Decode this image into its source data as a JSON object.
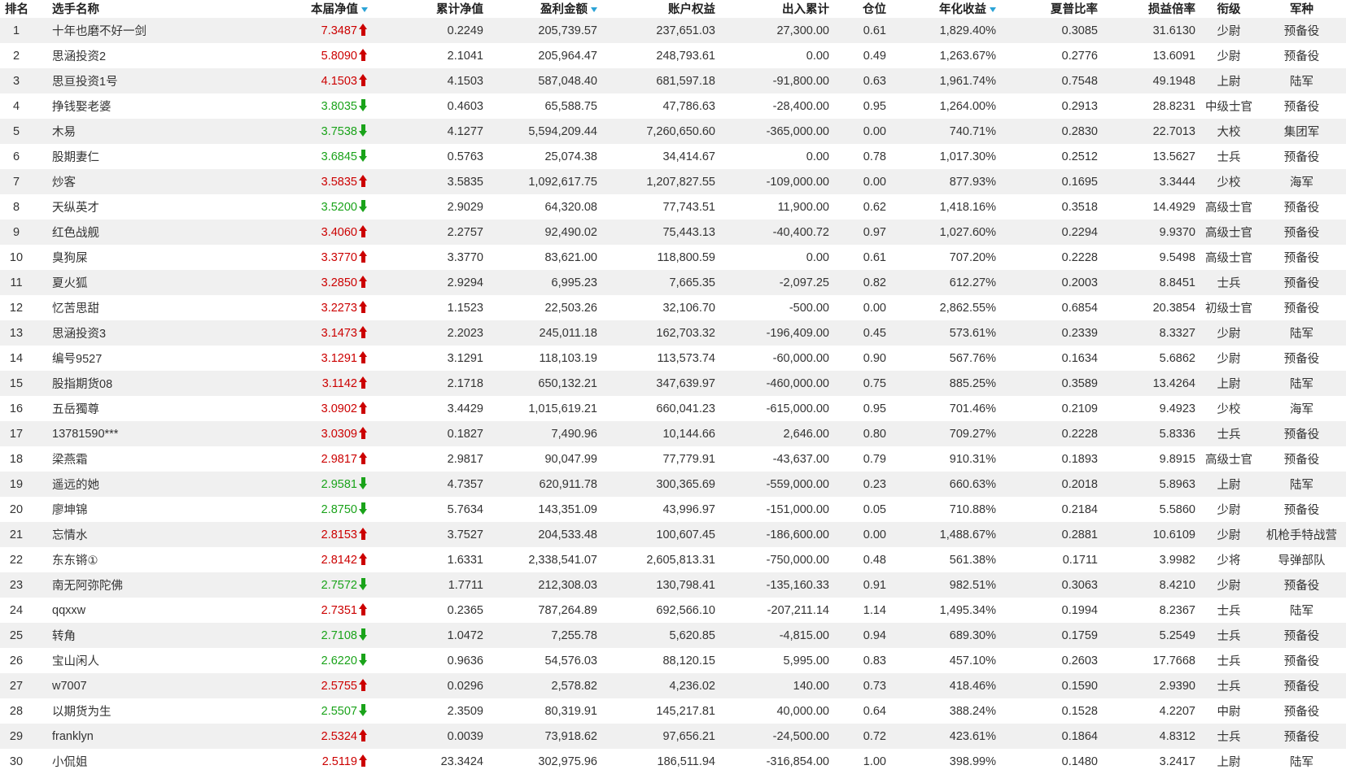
{
  "headers": {
    "rank": "排名",
    "name": "选手名称",
    "nav": "本届净值",
    "cum_nav": "累计净值",
    "profit": "盈利金额",
    "equity": "账户权益",
    "flow": "出入累计",
    "position": "仓位",
    "annual": "年化收益",
    "sharpe": "夏普比率",
    "pl_ratio": "损益倍率",
    "rank_title": "衔级",
    "army": "军种"
  },
  "rows": [
    {
      "rank": "1",
      "name": "十年也磨不好一剑",
      "nav": "7.3487",
      "dir": "up",
      "cum_nav": "0.2249",
      "profit": "205,739.57",
      "equity": "237,651.03",
      "flow": "27,300.00",
      "position": "0.61",
      "annual": "1,829.40%",
      "sharpe": "0.3085",
      "pl_ratio": "31.6130",
      "title": "少尉",
      "army": "预备役"
    },
    {
      "rank": "2",
      "name": "思涵投资2",
      "nav": "5.8090",
      "dir": "up",
      "cum_nav": "2.1041",
      "profit": "205,964.47",
      "equity": "248,793.61",
      "flow": "0.00",
      "position": "0.49",
      "annual": "1,263.67%",
      "sharpe": "0.2776",
      "pl_ratio": "13.6091",
      "title": "少尉",
      "army": "预备役"
    },
    {
      "rank": "3",
      "name": "思亘投资1号",
      "nav": "4.1503",
      "dir": "up",
      "cum_nav": "4.1503",
      "profit": "587,048.40",
      "equity": "681,597.18",
      "flow": "-91,800.00",
      "position": "0.63",
      "annual": "1,961.74%",
      "sharpe": "0.7548",
      "pl_ratio": "49.1948",
      "title": "上尉",
      "army": "陆军"
    },
    {
      "rank": "4",
      "name": "挣钱娶老婆",
      "nav": "3.8035",
      "dir": "down",
      "cum_nav": "0.4603",
      "profit": "65,588.75",
      "equity": "47,786.63",
      "flow": "-28,400.00",
      "position": "0.95",
      "annual": "1,264.00%",
      "sharpe": "0.2913",
      "pl_ratio": "28.8231",
      "title": "中级士官",
      "army": "预备役"
    },
    {
      "rank": "5",
      "name": "木易",
      "nav": "3.7538",
      "dir": "down",
      "cum_nav": "4.1277",
      "profit": "5,594,209.44",
      "equity": "7,260,650.60",
      "flow": "-365,000.00",
      "position": "0.00",
      "annual": "740.71%",
      "sharpe": "0.2830",
      "pl_ratio": "22.7013",
      "title": "大校",
      "army": "集团军"
    },
    {
      "rank": "6",
      "name": "股期妻仁",
      "nav": "3.6845",
      "dir": "down",
      "cum_nav": "0.5763",
      "profit": "25,074.38",
      "equity": "34,414.67",
      "flow": "0.00",
      "position": "0.78",
      "annual": "1,017.30%",
      "sharpe": "0.2512",
      "pl_ratio": "13.5627",
      "title": "士兵",
      "army": "预备役"
    },
    {
      "rank": "7",
      "name": "炒客",
      "nav": "3.5835",
      "dir": "up",
      "cum_nav": "3.5835",
      "profit": "1,092,617.75",
      "equity": "1,207,827.55",
      "flow": "-109,000.00",
      "position": "0.00",
      "annual": "877.93%",
      "sharpe": "0.1695",
      "pl_ratio": "3.3444",
      "title": "少校",
      "army": "海军"
    },
    {
      "rank": "8",
      "name": "天纵英才",
      "nav": "3.5200",
      "dir": "down",
      "cum_nav": "2.9029",
      "profit": "64,320.08",
      "equity": "77,743.51",
      "flow": "11,900.00",
      "position": "0.62",
      "annual": "1,418.16%",
      "sharpe": "0.3518",
      "pl_ratio": "14.4929",
      "title": "高级士官",
      "army": "预备役"
    },
    {
      "rank": "9",
      "name": "红色战舰",
      "nav": "3.4060",
      "dir": "up",
      "cum_nav": "2.2757",
      "profit": "92,490.02",
      "equity": "75,443.13",
      "flow": "-40,400.72",
      "position": "0.97",
      "annual": "1,027.60%",
      "sharpe": "0.2294",
      "pl_ratio": "9.9370",
      "title": "高级士官",
      "army": "预备役"
    },
    {
      "rank": "10",
      "name": "臭狗屎",
      "nav": "3.3770",
      "dir": "up",
      "cum_nav": "3.3770",
      "profit": "83,621.00",
      "equity": "118,800.59",
      "flow": "0.00",
      "position": "0.61",
      "annual": "707.20%",
      "sharpe": "0.2228",
      "pl_ratio": "9.5498",
      "title": "高级士官",
      "army": "预备役"
    },
    {
      "rank": "11",
      "name": "夏火狐",
      "nav": "3.2850",
      "dir": "up",
      "cum_nav": "2.9294",
      "profit": "6,995.23",
      "equity": "7,665.35",
      "flow": "-2,097.25",
      "position": "0.82",
      "annual": "612.27%",
      "sharpe": "0.2003",
      "pl_ratio": "8.8451",
      "title": "士兵",
      "army": "预备役"
    },
    {
      "rank": "12",
      "name": "忆苦思甜",
      "nav": "3.2273",
      "dir": "up",
      "cum_nav": "1.1523",
      "profit": "22,503.26",
      "equity": "32,106.70",
      "flow": "-500.00",
      "position": "0.00",
      "annual": "2,862.55%",
      "sharpe": "0.6854",
      "pl_ratio": "20.3854",
      "title": "初级士官",
      "army": "预备役"
    },
    {
      "rank": "13",
      "name": "思涵投资3",
      "nav": "3.1473",
      "dir": "up",
      "cum_nav": "2.2023",
      "profit": "245,011.18",
      "equity": "162,703.32",
      "flow": "-196,409.00",
      "position": "0.45",
      "annual": "573.61%",
      "sharpe": "0.2339",
      "pl_ratio": "8.3327",
      "title": "少尉",
      "army": "陆军"
    },
    {
      "rank": "14",
      "name": "编号9527",
      "nav": "3.1291",
      "dir": "up",
      "cum_nav": "3.1291",
      "profit": "118,103.19",
      "equity": "113,573.74",
      "flow": "-60,000.00",
      "position": "0.90",
      "annual": "567.76%",
      "sharpe": "0.1634",
      "pl_ratio": "5.6862",
      "title": "少尉",
      "army": "预备役"
    },
    {
      "rank": "15",
      "name": "股指期货08",
      "nav": "3.1142",
      "dir": "up",
      "cum_nav": "2.1718",
      "profit": "650,132.21",
      "equity": "347,639.97",
      "flow": "-460,000.00",
      "position": "0.75",
      "annual": "885.25%",
      "sharpe": "0.3589",
      "pl_ratio": "13.4264",
      "title": "上尉",
      "army": "陆军"
    },
    {
      "rank": "16",
      "name": "五岳獨尊",
      "nav": "3.0902",
      "dir": "up",
      "cum_nav": "3.4429",
      "profit": "1,015,619.21",
      "equity": "660,041.23",
      "flow": "-615,000.00",
      "position": "0.95",
      "annual": "701.46%",
      "sharpe": "0.2109",
      "pl_ratio": "9.4923",
      "title": "少校",
      "army": "海军"
    },
    {
      "rank": "17",
      "name": "13781590***",
      "nav": "3.0309",
      "dir": "up",
      "cum_nav": "0.1827",
      "profit": "7,490.96",
      "equity": "10,144.66",
      "flow": "2,646.00",
      "position": "0.80",
      "annual": "709.27%",
      "sharpe": "0.2228",
      "pl_ratio": "5.8336",
      "title": "士兵",
      "army": "预备役"
    },
    {
      "rank": "18",
      "name": "梁燕霜",
      "nav": "2.9817",
      "dir": "up",
      "cum_nav": "2.9817",
      "profit": "90,047.99",
      "equity": "77,779.91",
      "flow": "-43,637.00",
      "position": "0.79",
      "annual": "910.31%",
      "sharpe": "0.1893",
      "pl_ratio": "9.8915",
      "title": "高级士官",
      "army": "预备役"
    },
    {
      "rank": "19",
      "name": "遥远的她",
      "nav": "2.9581",
      "dir": "down",
      "cum_nav": "4.7357",
      "profit": "620,911.78",
      "equity": "300,365.69",
      "flow": "-559,000.00",
      "position": "0.23",
      "annual": "660.63%",
      "sharpe": "0.2018",
      "pl_ratio": "5.8963",
      "title": "上尉",
      "army": "陆军"
    },
    {
      "rank": "20",
      "name": "廖坤锦",
      "nav": "2.8750",
      "dir": "down",
      "cum_nav": "5.7634",
      "profit": "143,351.09",
      "equity": "43,996.97",
      "flow": "-151,000.00",
      "position": "0.05",
      "annual": "710.88%",
      "sharpe": "0.2184",
      "pl_ratio": "5.5860",
      "title": "少尉",
      "army": "预备役"
    },
    {
      "rank": "21",
      "name": "忘情水",
      "nav": "2.8153",
      "dir": "up",
      "cum_nav": "3.7527",
      "profit": "204,533.48",
      "equity": "100,607.45",
      "flow": "-186,600.00",
      "position": "0.00",
      "annual": "1,488.67%",
      "sharpe": "0.2881",
      "pl_ratio": "10.6109",
      "title": "少尉",
      "army": "机枪手特战营"
    },
    {
      "rank": "22",
      "name": "东东锵①",
      "nav": "2.8142",
      "dir": "up",
      "cum_nav": "1.6331",
      "profit": "2,338,541.07",
      "equity": "2,605,813.31",
      "flow": "-750,000.00",
      "position": "0.48",
      "annual": "561.38%",
      "sharpe": "0.1711",
      "pl_ratio": "3.9982",
      "title": "少将",
      "army": "导弹部队"
    },
    {
      "rank": "23",
      "name": "南无阿弥陀佛",
      "nav": "2.7572",
      "dir": "down",
      "cum_nav": "1.7711",
      "profit": "212,308.03",
      "equity": "130,798.41",
      "flow": "-135,160.33",
      "position": "0.91",
      "annual": "982.51%",
      "sharpe": "0.3063",
      "pl_ratio": "8.4210",
      "title": "少尉",
      "army": "预备役"
    },
    {
      "rank": "24",
      "name": "qqxxw",
      "nav": "2.7351",
      "dir": "up",
      "cum_nav": "0.2365",
      "profit": "787,264.89",
      "equity": "692,566.10",
      "flow": "-207,211.14",
      "position": "1.14",
      "annual": "1,495.34%",
      "sharpe": "0.1994",
      "pl_ratio": "8.2367",
      "title": "士兵",
      "army": "陆军"
    },
    {
      "rank": "25",
      "name": "转角",
      "nav": "2.7108",
      "dir": "down",
      "cum_nav": "1.0472",
      "profit": "7,255.78",
      "equity": "5,620.85",
      "flow": "-4,815.00",
      "position": "0.94",
      "annual": "689.30%",
      "sharpe": "0.1759",
      "pl_ratio": "5.2549",
      "title": "士兵",
      "army": "预备役"
    },
    {
      "rank": "26",
      "name": "宝山闲人",
      "nav": "2.6220",
      "dir": "down",
      "cum_nav": "0.9636",
      "profit": "54,576.03",
      "equity": "88,120.15",
      "flow": "5,995.00",
      "position": "0.83",
      "annual": "457.10%",
      "sharpe": "0.2603",
      "pl_ratio": "17.7668",
      "title": "士兵",
      "army": "预备役"
    },
    {
      "rank": "27",
      "name": "w7007",
      "nav": "2.5755",
      "dir": "up",
      "cum_nav": "0.0296",
      "profit": "2,578.82",
      "equity": "4,236.02",
      "flow": "140.00",
      "position": "0.73",
      "annual": "418.46%",
      "sharpe": "0.1590",
      "pl_ratio": "2.9390",
      "title": "士兵",
      "army": "预备役"
    },
    {
      "rank": "28",
      "name": "以期货为生",
      "nav": "2.5507",
      "dir": "down",
      "cum_nav": "2.3509",
      "profit": "80,319.91",
      "equity": "145,217.81",
      "flow": "40,000.00",
      "position": "0.64",
      "annual": "388.24%",
      "sharpe": "0.1528",
      "pl_ratio": "4.2207",
      "title": "中尉",
      "army": "预备役"
    },
    {
      "rank": "29",
      "name": "franklyn",
      "nav": "2.5324",
      "dir": "up",
      "cum_nav": "0.0039",
      "profit": "73,918.62",
      "equity": "97,656.21",
      "flow": "-24,500.00",
      "position": "0.72",
      "annual": "423.61%",
      "sharpe": "0.1864",
      "pl_ratio": "4.8312",
      "title": "士兵",
      "army": "预备役"
    },
    {
      "rank": "30",
      "name": "小侃姐",
      "nav": "2.5119",
      "dir": "up",
      "cum_nav": "23.3424",
      "profit": "302,975.96",
      "equity": "186,511.94",
      "flow": "-316,854.00",
      "position": "1.00",
      "annual": "398.99%",
      "sharpe": "0.1480",
      "pl_ratio": "3.2417",
      "title": "上尉",
      "army": "陆军"
    }
  ],
  "colors": {
    "up": "#cc0000",
    "down": "#1aa31a",
    "stripe": "#f0f0f0",
    "sort_icon": "#2ba3d6"
  },
  "icons": {
    "sort": "sort-desc-icon",
    "up": "arrow-up-icon",
    "down": "arrow-down-icon"
  }
}
